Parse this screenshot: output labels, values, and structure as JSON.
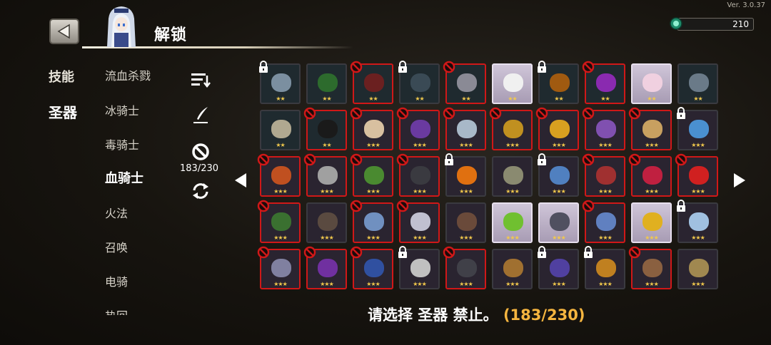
{
  "version": "Ver. 3.0.37",
  "header": {
    "title": "解锁"
  },
  "currency": {
    "value": "210",
    "icon": "gem-icon"
  },
  "categories": [
    {
      "label": "技能",
      "active": false
    },
    {
      "label": "圣器",
      "active": true
    }
  ],
  "classes": [
    {
      "label": "流血杀戮",
      "active": false
    },
    {
      "label": "冰骑士",
      "active": false
    },
    {
      "label": "毒骑士",
      "active": false
    },
    {
      "label": "血骑士",
      "active": true
    },
    {
      "label": "火法",
      "active": false
    },
    {
      "label": "召唤",
      "active": false
    },
    {
      "label": "电骑",
      "active": false
    },
    {
      "label": "热回",
      "active": false
    }
  ],
  "tools": {
    "sort_icon": "sort-icon",
    "edit_icon": "quill-icon",
    "ban_icon": "ban-icon",
    "refresh_icon": "refresh-icon",
    "counter": "183/230"
  },
  "prompt": {
    "text": "请选择 圣器 禁止。",
    "count": "(183/230)"
  },
  "colors": {
    "banned_border": "#d01818",
    "star": "#f2c94c",
    "count_accent": "#f5b53f"
  },
  "relics": [
    [
      {
        "stars": 2,
        "status": "locked",
        "color": "#7b8fa0"
      },
      {
        "stars": 2,
        "status": "normal",
        "color": "#2d6b2d"
      },
      {
        "stars": 2,
        "status": "banned",
        "color": "#6b2020"
      },
      {
        "stars": 2,
        "status": "locked",
        "color": "#3a4a55"
      },
      {
        "stars": 2,
        "status": "banned",
        "color": "#8a8a95"
      },
      {
        "stars": 2,
        "status": "selected",
        "color": "#f0f0f0"
      },
      {
        "stars": 2,
        "status": "locked",
        "color": "#a05a10"
      },
      {
        "stars": 2,
        "status": "banned",
        "color": "#8a2ab0"
      },
      {
        "stars": 2,
        "status": "selected",
        "color": "#f0d0e0"
      },
      {
        "stars": 2,
        "status": "normal",
        "color": "#6a7a88"
      }
    ],
    [
      {
        "stars": 2,
        "status": "normal",
        "color": "#b0a890"
      },
      {
        "stars": 2,
        "status": "banned",
        "color": "#1a1a1a"
      },
      {
        "stars": 3,
        "status": "banned",
        "color": "#d8c0a0"
      },
      {
        "stars": 3,
        "status": "banned",
        "color": "#6a3aa0"
      },
      {
        "stars": 3,
        "status": "banned",
        "color": "#a8b8c8"
      },
      {
        "stars": 3,
        "status": "banned",
        "color": "#c09020"
      },
      {
        "stars": 3,
        "status": "banned",
        "color": "#d8a020"
      },
      {
        "stars": 3,
        "status": "banned",
        "color": "#8050b0"
      },
      {
        "stars": 3,
        "status": "banned",
        "color": "#c8a060"
      },
      {
        "stars": 3,
        "status": "locked",
        "color": "#4a90d0"
      }
    ],
    [
      {
        "stars": 3,
        "status": "banned",
        "color": "#c05020"
      },
      {
        "stars": 3,
        "status": "banned",
        "color": "#a0a0a0"
      },
      {
        "stars": 3,
        "status": "banned",
        "color": "#4a8a30"
      },
      {
        "stars": 3,
        "status": "banned",
        "color": "#3a3a40"
      },
      {
        "stars": 3,
        "status": "locked",
        "color": "#e07010"
      },
      {
        "stars": 3,
        "status": "normal",
        "color": "#8a8a70"
      },
      {
        "stars": 3,
        "status": "locked",
        "color": "#5080c0"
      },
      {
        "stars": 3,
        "status": "banned",
        "color": "#a03030"
      },
      {
        "stars": 3,
        "status": "banned",
        "color": "#c02040"
      },
      {
        "stars": 3,
        "status": "banned",
        "color": "#d02020"
      }
    ],
    [
      {
        "stars": 3,
        "status": "banned",
        "color": "#3a7030"
      },
      {
        "stars": 3,
        "status": "normal",
        "color": "#5a4a40"
      },
      {
        "stars": 3,
        "status": "banned",
        "color": "#7090c0"
      },
      {
        "stars": 3,
        "status": "banned",
        "color": "#c0c0d0"
      },
      {
        "stars": 3,
        "status": "normal",
        "color": "#6a4a3a"
      },
      {
        "stars": 3,
        "status": "selected",
        "color": "#70c030"
      },
      {
        "stars": 3,
        "status": "selected",
        "color": "#505060"
      },
      {
        "stars": 3,
        "status": "banned",
        "color": "#6080c0"
      },
      {
        "stars": 3,
        "status": "selected",
        "color": "#e0b020"
      },
      {
        "stars": 3,
        "status": "locked",
        "color": "#a0c0e0"
      }
    ],
    [
      {
        "stars": 3,
        "status": "banned",
        "color": "#8080a0"
      },
      {
        "stars": 3,
        "status": "banned",
        "color": "#7030a0"
      },
      {
        "stars": 3,
        "status": "banned",
        "color": "#3050a0"
      },
      {
        "stars": 3,
        "status": "locked",
        "color": "#c0c0c0"
      },
      {
        "stars": 3,
        "status": "banned",
        "color": "#404048"
      },
      {
        "stars": 3,
        "status": "normal",
        "color": "#a07030"
      },
      {
        "stars": 3,
        "status": "locked",
        "color": "#5040a0"
      },
      {
        "stars": 3,
        "status": "locked",
        "color": "#c08020"
      },
      {
        "stars": 3,
        "status": "banned",
        "color": "#8a6040"
      },
      {
        "stars": 3,
        "status": "normal",
        "color": "#a08850"
      }
    ]
  ]
}
